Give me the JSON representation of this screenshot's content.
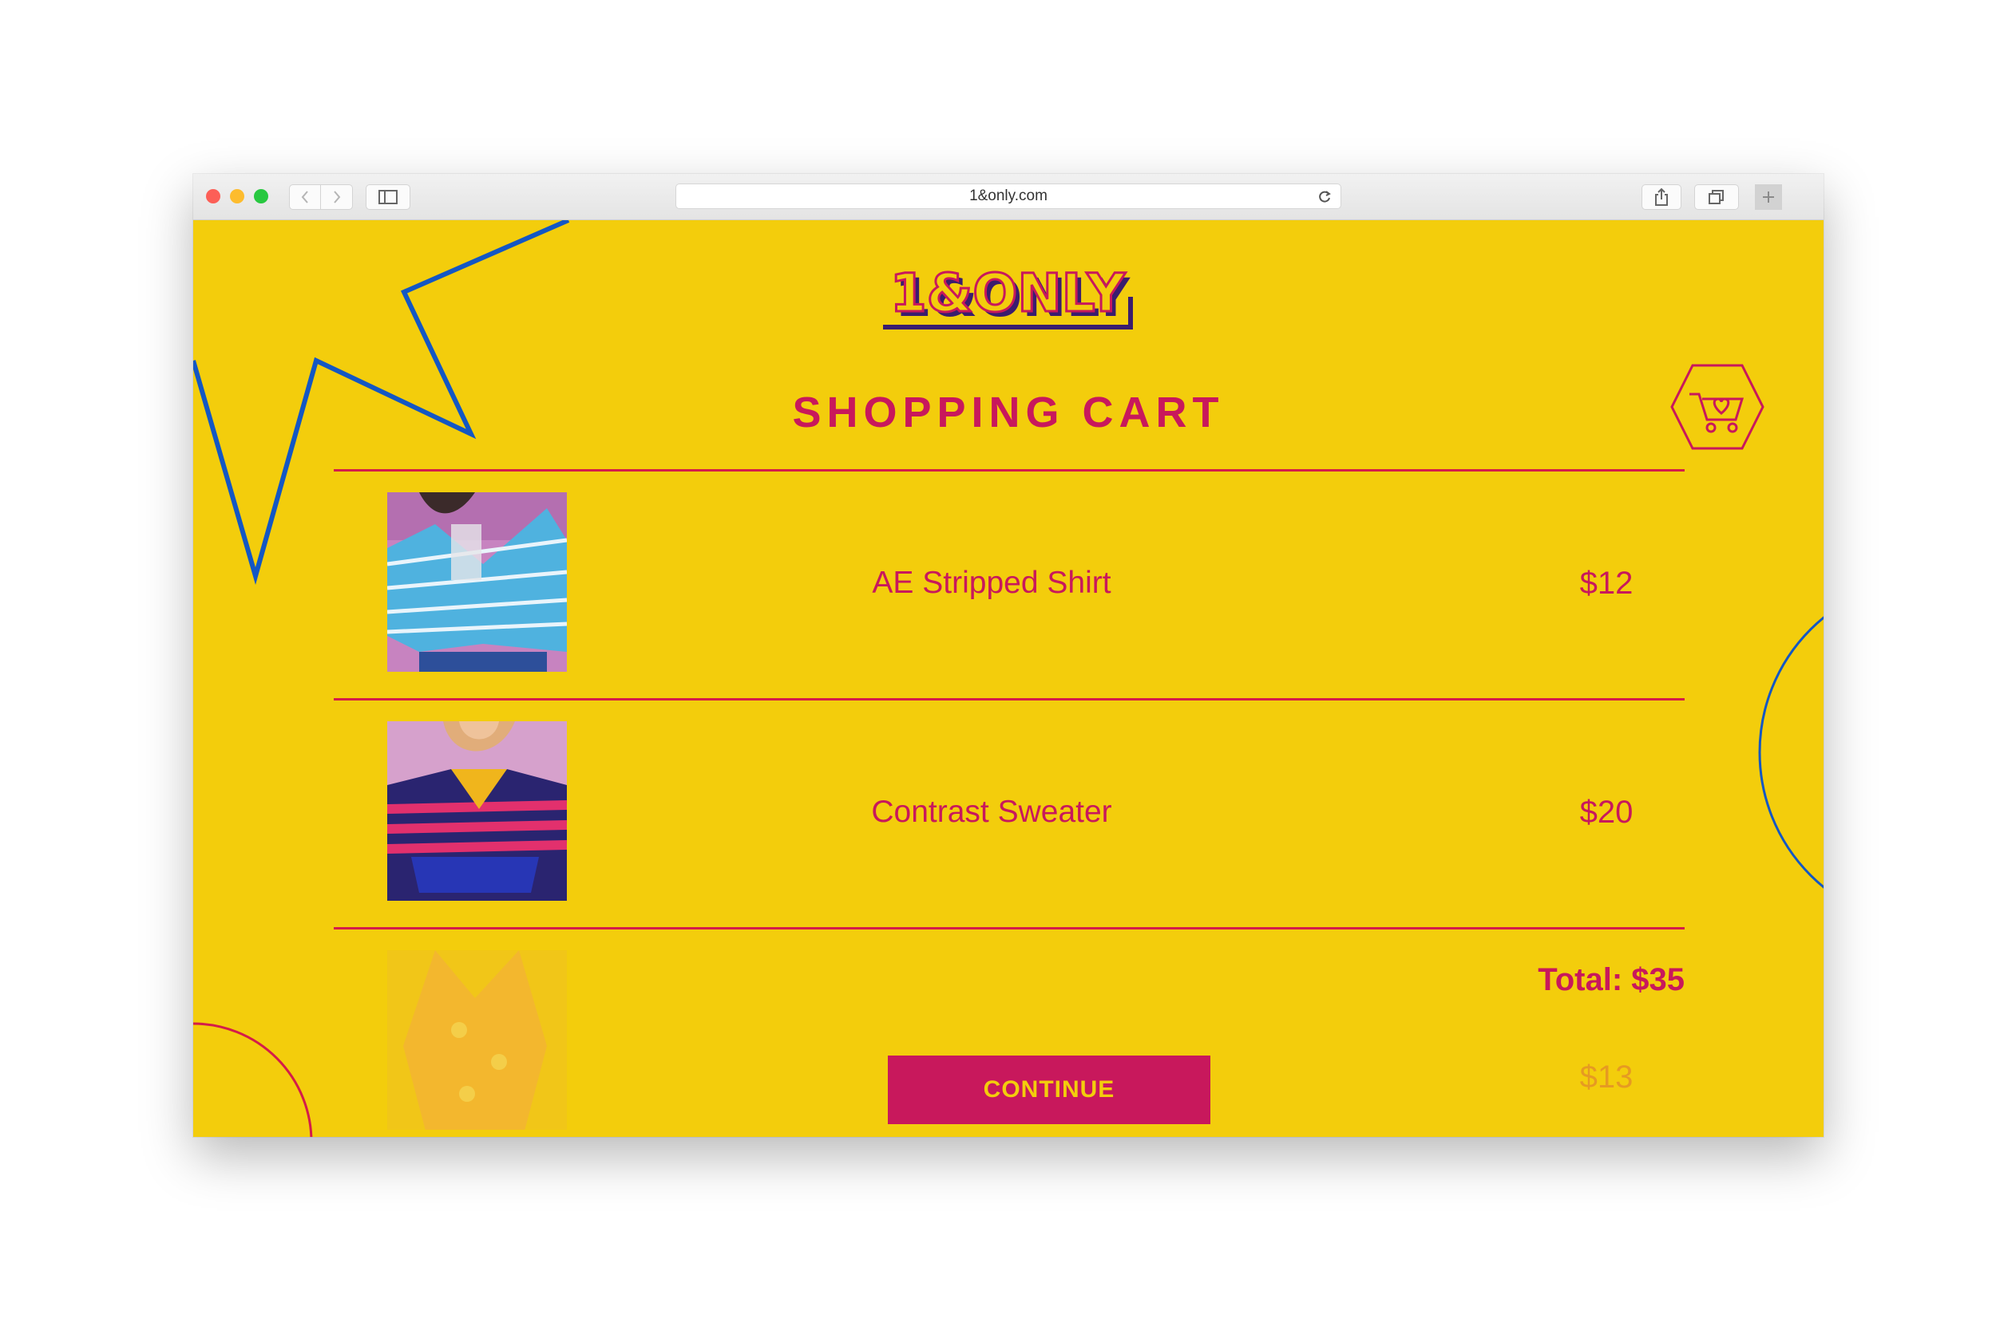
{
  "browser": {
    "url": "1&only.com"
  },
  "brand": {
    "logo_text": "1&ONLY",
    "accent": "#c8185c",
    "background": "#f3cd0c",
    "decor_blue": "#1357c4"
  },
  "page": {
    "title": "SHOPPING CART"
  },
  "cart": {
    "items": [
      {
        "name": "AE Stripped Shirt",
        "price": "$12"
      },
      {
        "name": "Contrast Sweater",
        "price": "$20"
      },
      {
        "name": "",
        "price": "$13"
      }
    ],
    "total_label": "Total: $35",
    "continue_label": "CONTINUE"
  }
}
